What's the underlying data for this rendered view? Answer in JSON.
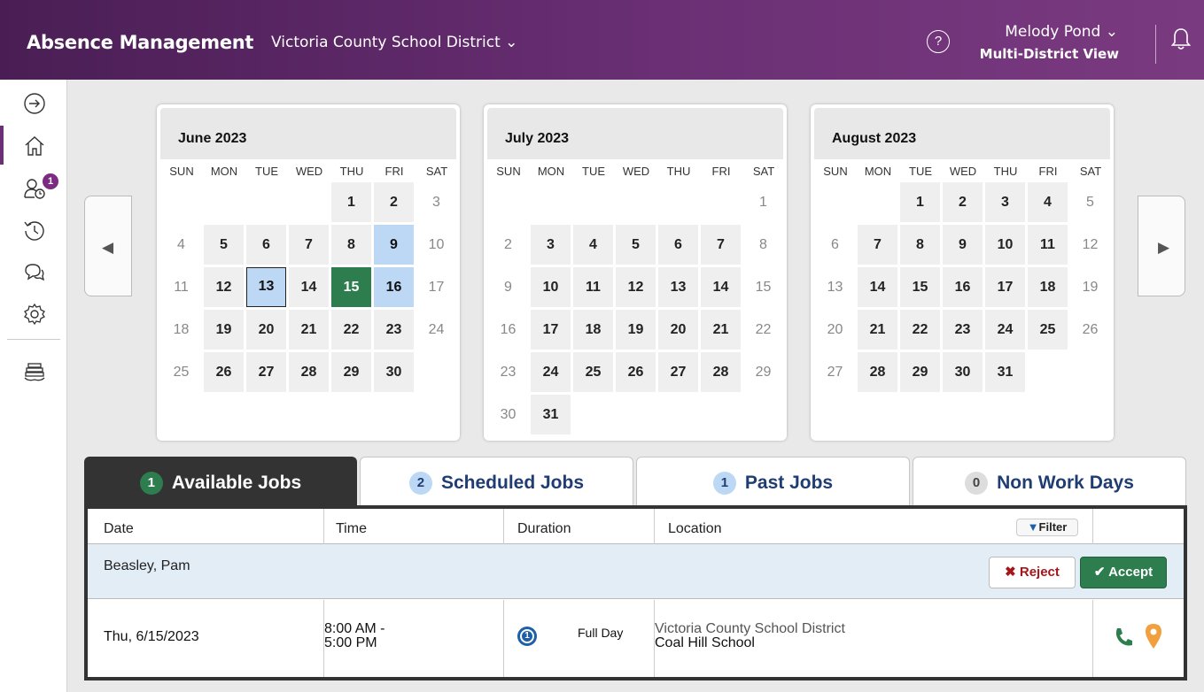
{
  "header": {
    "app_title": "Absence Management",
    "district": "Victoria County School District ⌄",
    "help": "?",
    "user_name": "Melody Pond ⌄",
    "user_view": "Multi-District View"
  },
  "sidebar": {
    "items": [
      {
        "icon": "expand-arrow-icon"
      },
      {
        "icon": "home-icon"
      },
      {
        "icon": "absences-icon",
        "badge": "1"
      },
      {
        "icon": "history-icon"
      },
      {
        "icon": "messages-icon"
      },
      {
        "icon": "settings-icon"
      },
      {
        "icon": "stack-icon"
      }
    ]
  },
  "nav": {
    "prev": "◀",
    "next": "▶"
  },
  "dow": [
    "SUN",
    "MON",
    "TUE",
    "WED",
    "THU",
    "FRI",
    "SAT"
  ],
  "calendars": [
    {
      "title": "June 2023",
      "first_weekday": 4,
      "days": 30,
      "blue": [
        9,
        16
      ],
      "selected": 13,
      "green": 15
    },
    {
      "title": "July 2023",
      "first_weekday": 6,
      "days": 31,
      "blue": [],
      "selected": null,
      "green": null
    },
    {
      "title": "August 2023",
      "first_weekday": 2,
      "days": 31,
      "blue": [],
      "selected": null,
      "green": null
    }
  ],
  "tabs": [
    {
      "count": "1",
      "label": "Available Jobs",
      "active": true
    },
    {
      "count": "2",
      "label": "Scheduled Jobs",
      "active": false
    },
    {
      "count": "1",
      "label": "Past Jobs",
      "active": false
    },
    {
      "count": "0",
      "label": "Non Work Days",
      "active": false
    }
  ],
  "table": {
    "columns": [
      "Date",
      "Time",
      "Duration",
      "Location"
    ],
    "filter_label": "Filter",
    "group": "Beasley, Pam",
    "reject_label": "Reject",
    "accept_label": "Accept",
    "row": {
      "date": "Thu, 6/15/2023",
      "time_start": "8:00 AM -",
      "time_end": "5:00 PM",
      "duration_icon_num": "1",
      "duration": "Full Day",
      "location_district": "Victoria County School District",
      "location_school": "Coal Hill School"
    }
  },
  "colors": {
    "brand": "#6a2f74",
    "accent_green": "#2e7d4f",
    "accent_blue": "#bcd8f5",
    "tab_text": "#1f3d73"
  }
}
